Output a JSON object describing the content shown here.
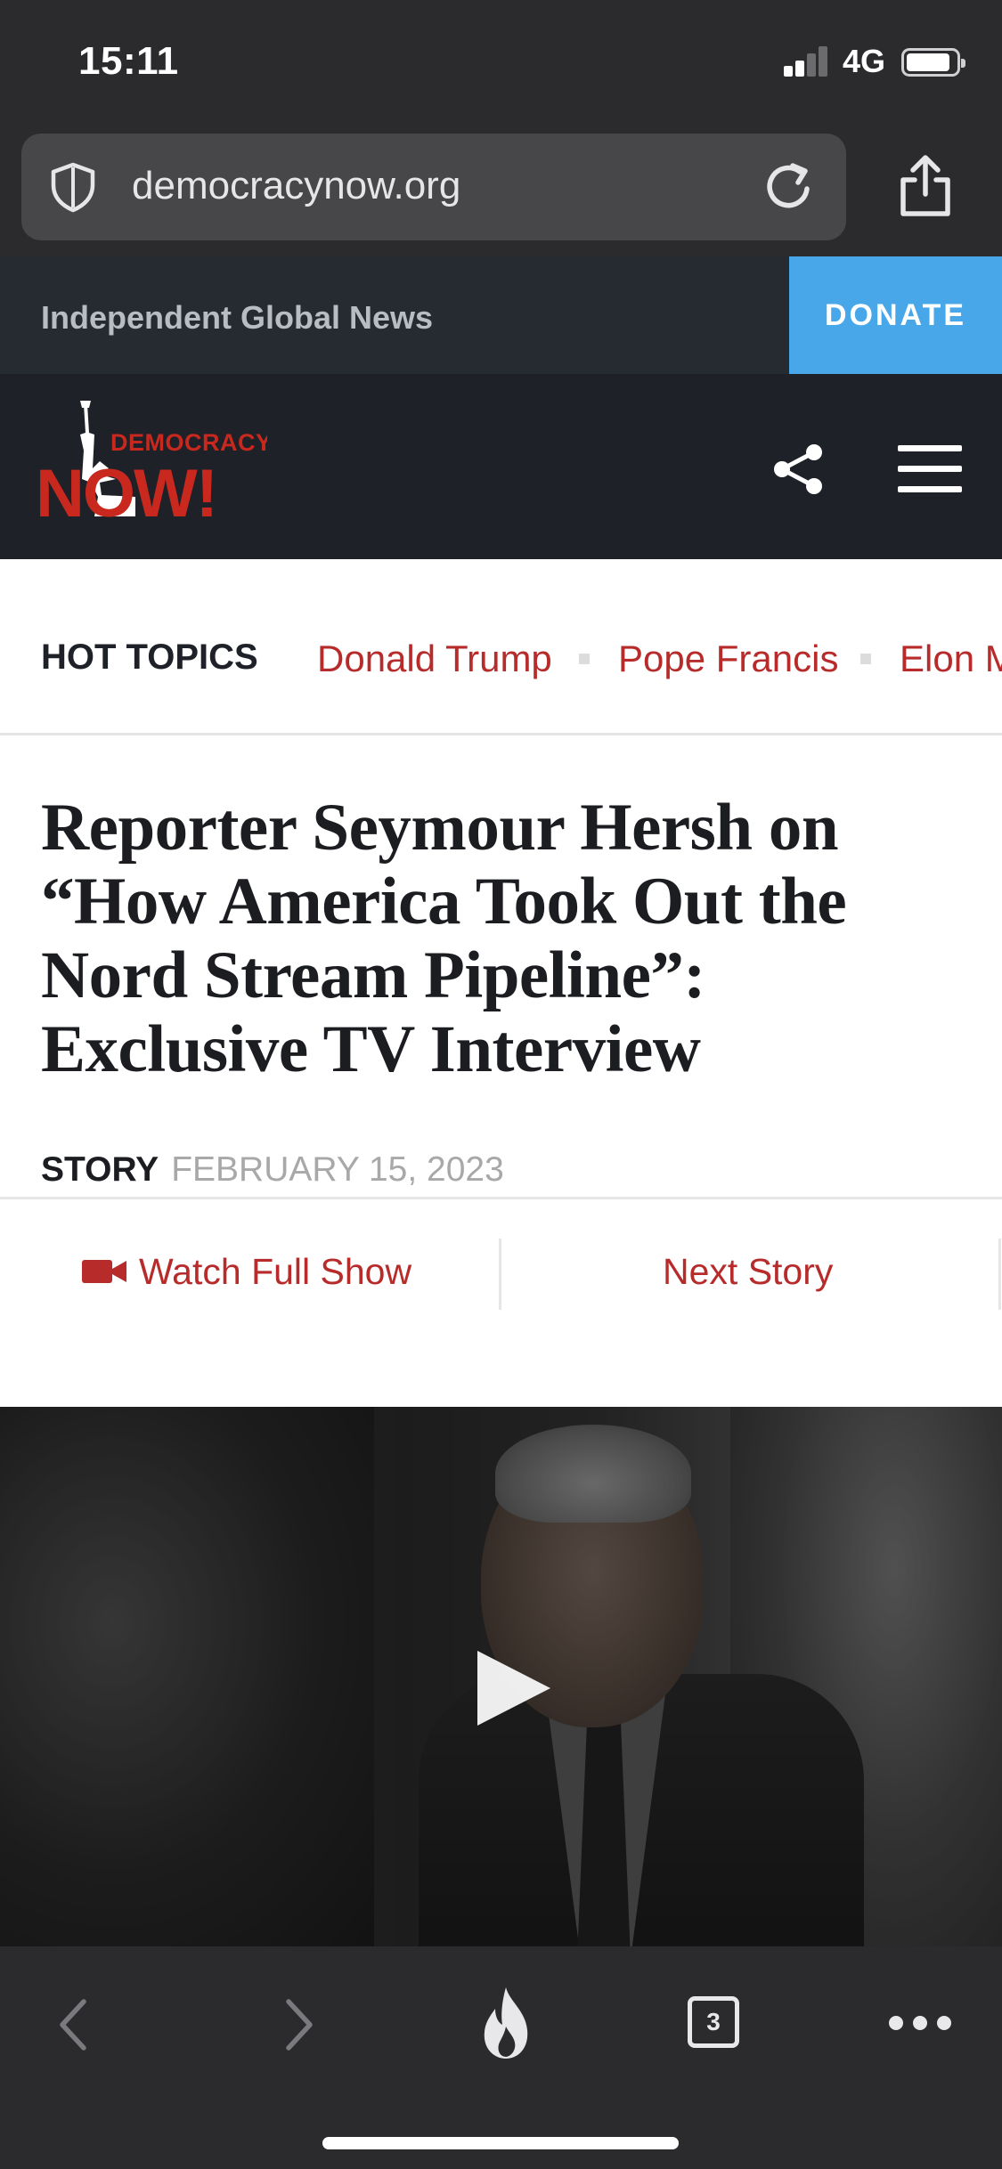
{
  "status_bar": {
    "time": "15:11",
    "network": "4G"
  },
  "browser": {
    "url": "democracynow.org",
    "open_tabs": "3"
  },
  "site": {
    "tagline": "Independent Global News",
    "donate_label": "DONATE",
    "logo_text_top": "DEMOCRACY",
    "logo_text_bottom": "NOW!",
    "brand_red": "#c8281e",
    "accent_blue": "#48a7e8"
  },
  "hot_topics": {
    "label": "HOT TOPICS",
    "items": [
      "Donald Trump",
      "Pope Francis",
      "Elon M"
    ]
  },
  "article": {
    "headline": "Reporter Seymour Hersh on “How America Took Out the Nord Stream Pipeline”: Exclusive TV Interview",
    "type": "STORY",
    "date": "FEBRUARY 15, 2023",
    "watch_full_show": "Watch Full Show",
    "next_story": "Next Story"
  },
  "icons": {
    "url_shield": "shield-icon",
    "reload": "reload-icon",
    "share": "share-icon",
    "menu": "hamburger-menu-icon",
    "camera": "video-camera-icon",
    "play": "play-icon",
    "back": "chevron-left-icon",
    "forward": "chevron-right-icon",
    "flame": "flame-icon",
    "tabs": "tabs-icon",
    "more": "more-dots-icon"
  }
}
